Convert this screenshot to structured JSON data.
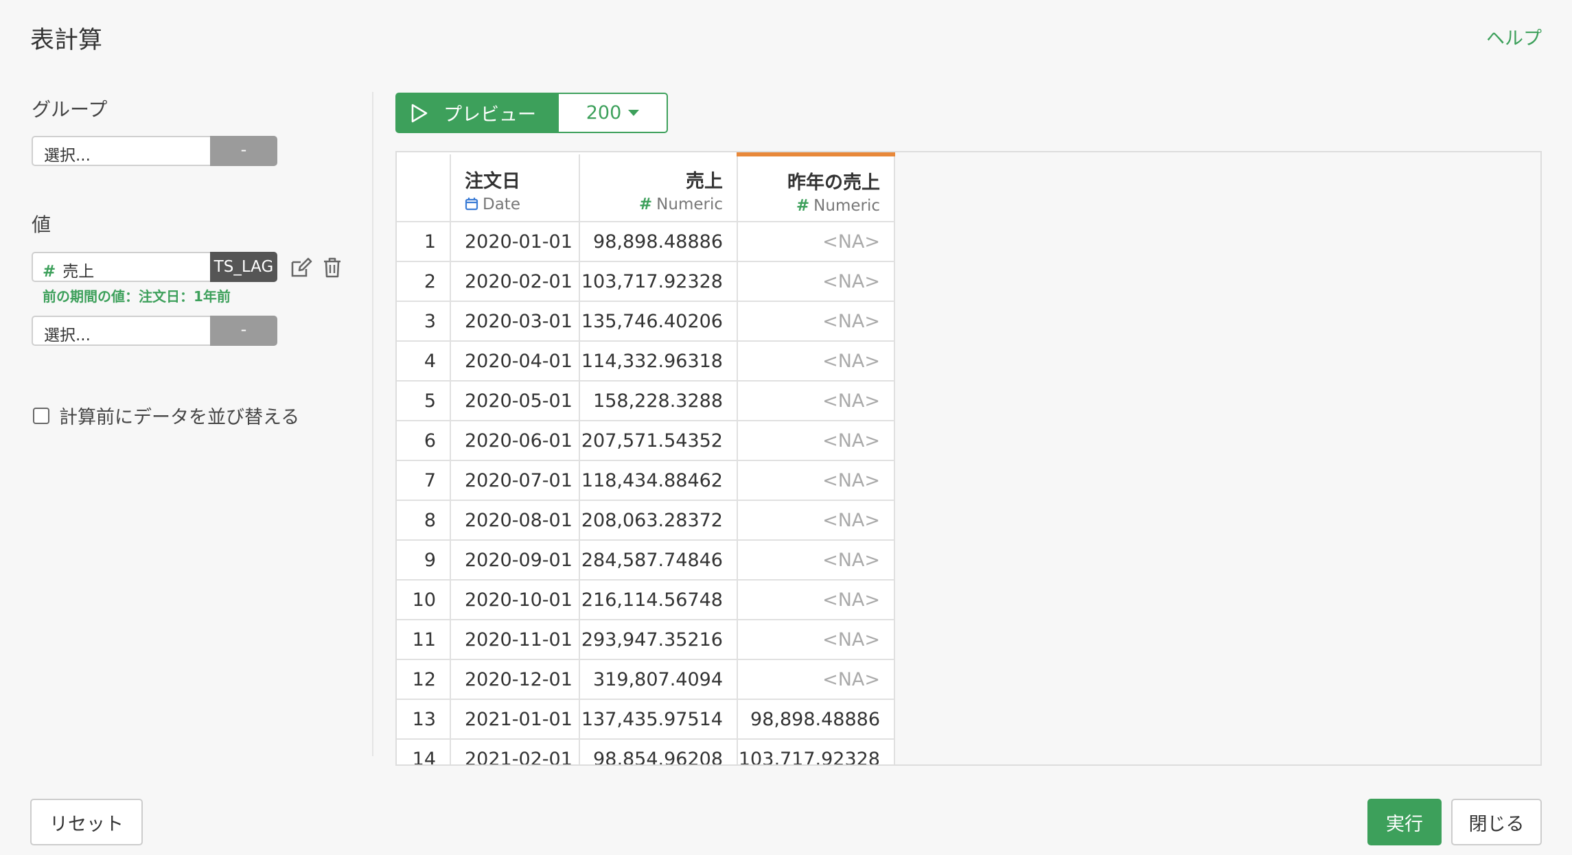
{
  "header": {
    "title": "表計算",
    "help": "ヘルプ"
  },
  "left": {
    "group_label": "グループ",
    "group_select_placeholder": "選択...",
    "group_select_button": "-",
    "value_label": "値",
    "value_column": "売上",
    "value_column_icon": "#",
    "value_function": "TS_LAG",
    "value_description": "前の期間の値：注文日：1年前",
    "value_select_placeholder": "選択...",
    "value_select_button": "-",
    "sort_checkbox_label": "計算前にデータを並び替える",
    "sort_checked": false
  },
  "toolbar": {
    "preview_label": "プレビュー",
    "row_count": "200"
  },
  "table": {
    "columns": [
      {
        "name": "注文日",
        "type": "Date",
        "type_icon": "calendar-icon"
      },
      {
        "name": "売上",
        "type": "Numeric",
        "type_icon": "#"
      },
      {
        "name": "昨年の売上",
        "type": "Numeric",
        "type_icon": "#"
      }
    ],
    "rows": [
      [
        "1",
        "2020-01-01",
        "98,898.48886",
        "<NA>"
      ],
      [
        "2",
        "2020-02-01",
        "103,717.92328",
        "<NA>"
      ],
      [
        "3",
        "2020-03-01",
        "135,746.40206",
        "<NA>"
      ],
      [
        "4",
        "2020-04-01",
        "114,332.96318",
        "<NA>"
      ],
      [
        "5",
        "2020-05-01",
        "158,228.3288",
        "<NA>"
      ],
      [
        "6",
        "2020-06-01",
        "207,571.54352",
        "<NA>"
      ],
      [
        "7",
        "2020-07-01",
        "118,434.88462",
        "<NA>"
      ],
      [
        "8",
        "2020-08-01",
        "208,063.28372",
        "<NA>"
      ],
      [
        "9",
        "2020-09-01",
        "284,587.74846",
        "<NA>"
      ],
      [
        "10",
        "2020-10-01",
        "216,114.56748",
        "<NA>"
      ],
      [
        "11",
        "2020-11-01",
        "293,947.35216",
        "<NA>"
      ],
      [
        "12",
        "2020-12-01",
        "319,807.4094",
        "<NA>"
      ],
      [
        "13",
        "2021-01-01",
        "137,435.97514",
        "98,898.48886"
      ],
      [
        "14",
        "2021-02-01",
        "98,854.96208",
        "103,717.92328"
      ]
    ]
  },
  "footer": {
    "reset": "リセット",
    "run": "実行",
    "close": "閉じる"
  },
  "colors": {
    "accent": "#3da05b",
    "highlight_column": "#e8883a",
    "na_text": "#aaaaaa"
  }
}
